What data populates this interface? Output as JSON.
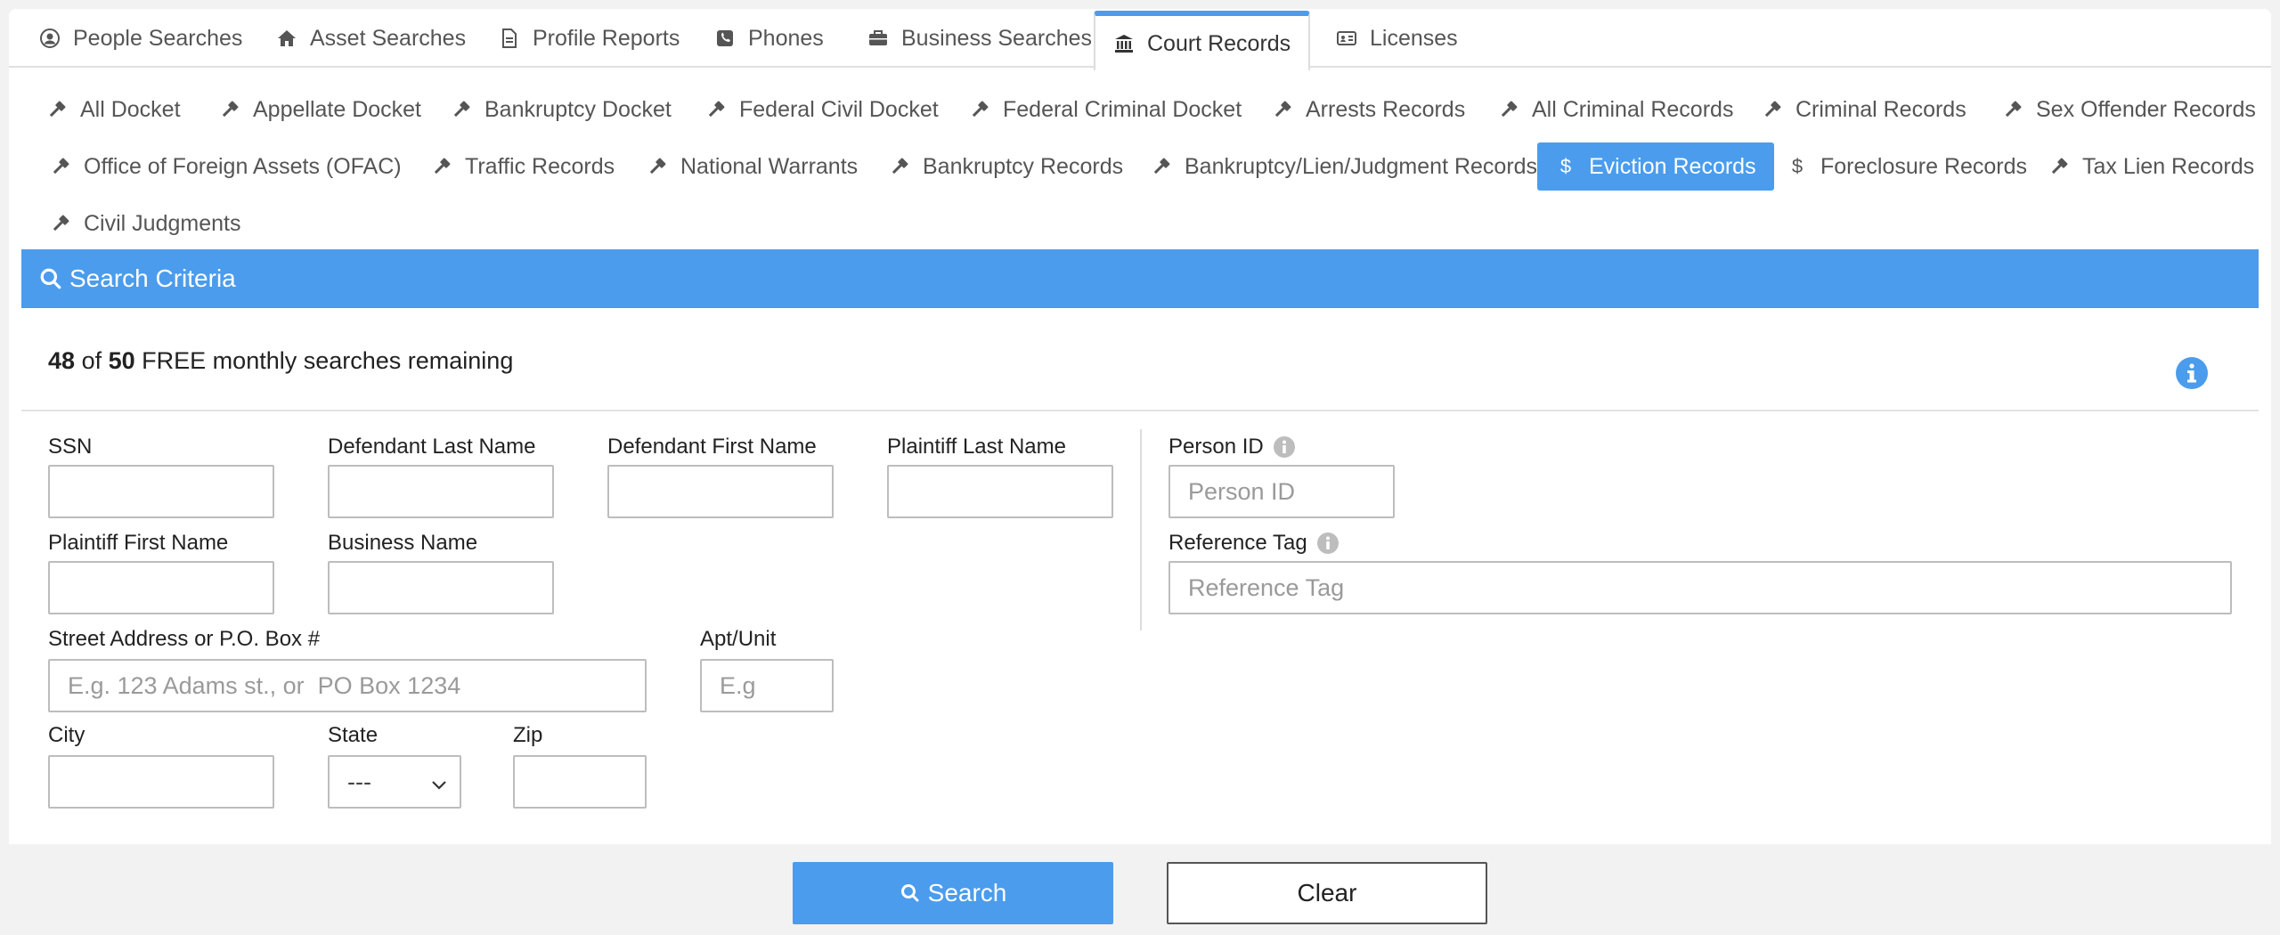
{
  "top_tabs": [
    {
      "label": "People Searches",
      "icon": "user-circle-icon"
    },
    {
      "label": "Asset Searches",
      "icon": "home-icon"
    },
    {
      "label": "Profile Reports",
      "icon": "document-icon"
    },
    {
      "label": "Phones",
      "icon": "phone-icon"
    },
    {
      "label": "Business Searches",
      "icon": "briefcase-icon"
    },
    {
      "label": "Court Records",
      "icon": "courthouse-icon",
      "active": true
    },
    {
      "label": "Licenses",
      "icon": "id-card-icon"
    }
  ],
  "sub_tabs": [
    {
      "label": "All Docket",
      "icon": "gavel-icon"
    },
    {
      "label": "Appellate Docket",
      "icon": "gavel-icon"
    },
    {
      "label": "Bankruptcy Docket",
      "icon": "gavel-icon"
    },
    {
      "label": "Federal Civil Docket",
      "icon": "gavel-icon"
    },
    {
      "label": "Federal Criminal Docket",
      "icon": "gavel-icon"
    },
    {
      "label": "Arrests Records",
      "icon": "gavel-icon"
    },
    {
      "label": "All Criminal Records",
      "icon": "gavel-icon"
    },
    {
      "label": "Criminal Records",
      "icon": "gavel-icon"
    },
    {
      "label": "Sex Offender Records",
      "icon": "gavel-icon"
    },
    {
      "label": "Office of Foreign Assets (OFAC)",
      "icon": "gavel-icon"
    },
    {
      "label": "Traffic Records",
      "icon": "gavel-icon"
    },
    {
      "label": "National Warrants",
      "icon": "gavel-icon"
    },
    {
      "label": "Bankruptcy Records",
      "icon": "gavel-icon"
    },
    {
      "label": "Bankruptcy/Lien/Judgment Records",
      "icon": "gavel-icon"
    },
    {
      "label": "Eviction Records",
      "icon": "dollar-icon",
      "active": true
    },
    {
      "label": "Foreclosure Records",
      "icon": "dollar-icon"
    },
    {
      "label": "Tax Lien Records",
      "icon": "gavel-icon"
    },
    {
      "label": "Civil Judgments",
      "icon": "gavel-icon"
    }
  ],
  "criteria": {
    "title": "Search Criteria",
    "remaining_used": "48",
    "remaining_of": "of",
    "remaining_total": "50",
    "remaining_text": "FREE monthly searches remaining"
  },
  "form": {
    "ssn_label": "SSN",
    "def_last_label": "Defendant Last Name",
    "def_first_label": "Defendant First Name",
    "pl_last_label": "Plaintiff Last Name",
    "pl_first_label": "Plaintiff First Name",
    "business_label": "Business Name",
    "street_label": "Street Address or P.O. Box #",
    "street_placeholder": "E.g. 123 Adams st., or  PO Box 1234",
    "apt_label": "Apt/Unit",
    "apt_placeholder": "E.g",
    "city_label": "City",
    "state_label": "State",
    "state_value": "---",
    "zip_label": "Zip",
    "person_id_label": "Person ID",
    "person_id_placeholder": "Person ID",
    "ref_tag_label": "Reference Tag",
    "ref_tag_placeholder": "Reference Tag"
  },
  "buttons": {
    "search": "Search",
    "clear": "Clear"
  },
  "colors": {
    "accent": "#4b9cec"
  }
}
